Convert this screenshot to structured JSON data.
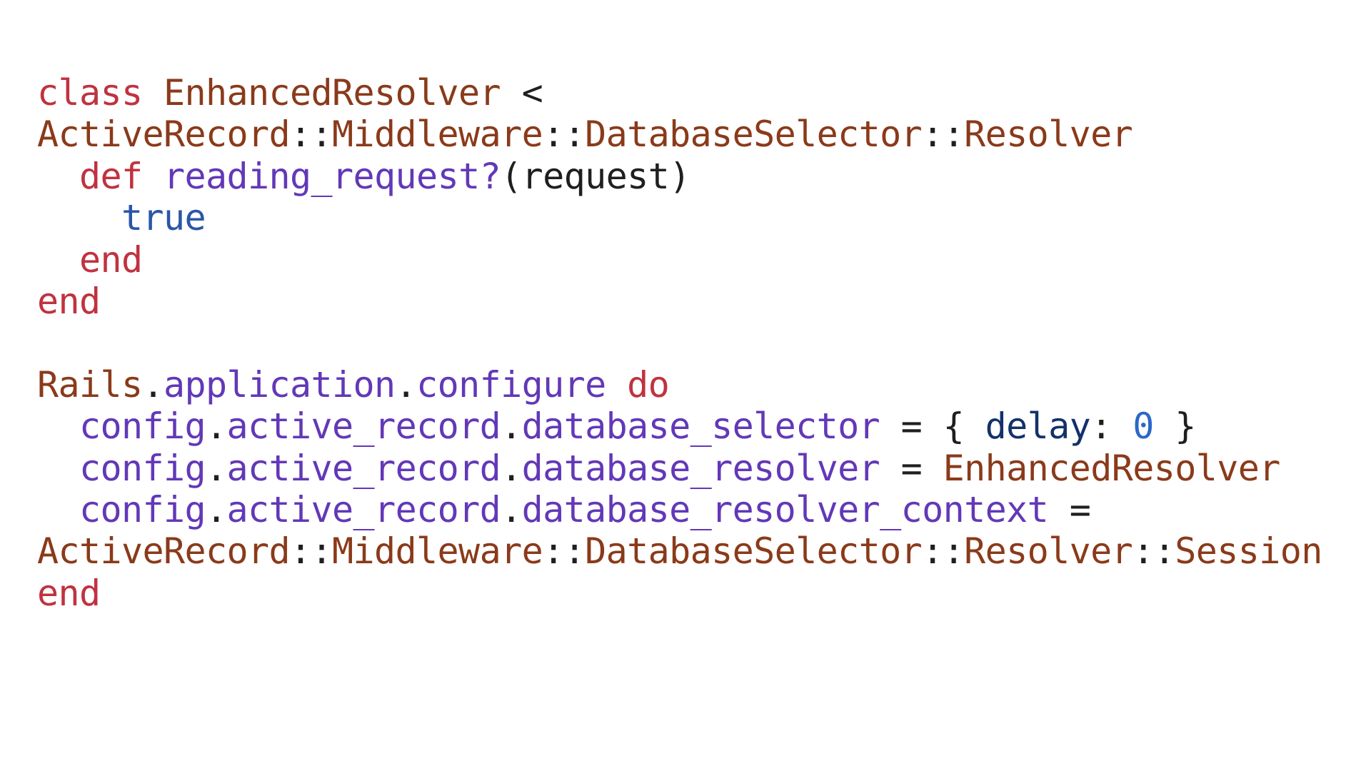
{
  "colors": {
    "keyword": "#c0323f",
    "constant": "#8a3a1a",
    "method": "#6238b8",
    "boolean": "#2a56a8",
    "symbol_key": "#13316a",
    "number": "#2a68c8",
    "plain": "#1f1f1f"
  },
  "code": {
    "lines": [
      [
        {
          "t": "class ",
          "k": "keyword"
        },
        {
          "t": "EnhancedResolver",
          "k": "constant"
        },
        {
          "t": " <",
          "k": "plain"
        }
      ],
      [
        {
          "t": "ActiveRecord",
          "k": "constant"
        },
        {
          "t": "::",
          "k": "plain"
        },
        {
          "t": "Middleware",
          "k": "constant"
        },
        {
          "t": "::",
          "k": "plain"
        },
        {
          "t": "DatabaseSelector",
          "k": "constant"
        },
        {
          "t": "::",
          "k": "plain"
        },
        {
          "t": "Resolver",
          "k": "constant"
        }
      ],
      [
        {
          "t": "  ",
          "k": "plain"
        },
        {
          "t": "def ",
          "k": "keyword"
        },
        {
          "t": "reading_request?",
          "k": "method"
        },
        {
          "t": "(request)",
          "k": "plain"
        }
      ],
      [
        {
          "t": "    ",
          "k": "plain"
        },
        {
          "t": "true",
          "k": "boolean"
        }
      ],
      [
        {
          "t": "  ",
          "k": "plain"
        },
        {
          "t": "end",
          "k": "keyword"
        }
      ],
      [
        {
          "t": "end",
          "k": "keyword"
        }
      ],
      [],
      [
        {
          "t": "Rails",
          "k": "constant"
        },
        {
          "t": ".",
          "k": "plain"
        },
        {
          "t": "application",
          "k": "method"
        },
        {
          "t": ".",
          "k": "plain"
        },
        {
          "t": "configure ",
          "k": "method"
        },
        {
          "t": "do",
          "k": "keyword"
        }
      ],
      [
        {
          "t": "  ",
          "k": "plain"
        },
        {
          "t": "config",
          "k": "method"
        },
        {
          "t": ".",
          "k": "plain"
        },
        {
          "t": "active_record",
          "k": "method"
        },
        {
          "t": ".",
          "k": "plain"
        },
        {
          "t": "database_selector",
          "k": "method"
        },
        {
          "t": " = { ",
          "k": "plain"
        },
        {
          "t": "delay",
          "k": "symbol_key"
        },
        {
          "t": ": ",
          "k": "plain"
        },
        {
          "t": "0",
          "k": "number"
        },
        {
          "t": " }",
          "k": "plain"
        }
      ],
      [
        {
          "t": "  ",
          "k": "plain"
        },
        {
          "t": "config",
          "k": "method"
        },
        {
          "t": ".",
          "k": "plain"
        },
        {
          "t": "active_record",
          "k": "method"
        },
        {
          "t": ".",
          "k": "plain"
        },
        {
          "t": "database_resolver",
          "k": "method"
        },
        {
          "t": " = ",
          "k": "plain"
        },
        {
          "t": "EnhancedResolver",
          "k": "constant"
        }
      ],
      [
        {
          "t": "  ",
          "k": "plain"
        },
        {
          "t": "config",
          "k": "method"
        },
        {
          "t": ".",
          "k": "plain"
        },
        {
          "t": "active_record",
          "k": "method"
        },
        {
          "t": ".",
          "k": "plain"
        },
        {
          "t": "database_resolver_context",
          "k": "method"
        },
        {
          "t": " =",
          "k": "plain"
        }
      ],
      [
        {
          "t": "ActiveRecord",
          "k": "constant"
        },
        {
          "t": "::",
          "k": "plain"
        },
        {
          "t": "Middleware",
          "k": "constant"
        },
        {
          "t": "::",
          "k": "plain"
        },
        {
          "t": "DatabaseSelector",
          "k": "constant"
        },
        {
          "t": "::",
          "k": "plain"
        },
        {
          "t": "Resolver",
          "k": "constant"
        },
        {
          "t": "::",
          "k": "plain"
        },
        {
          "t": "Session",
          "k": "constant"
        }
      ],
      [
        {
          "t": "end",
          "k": "keyword"
        }
      ]
    ]
  }
}
